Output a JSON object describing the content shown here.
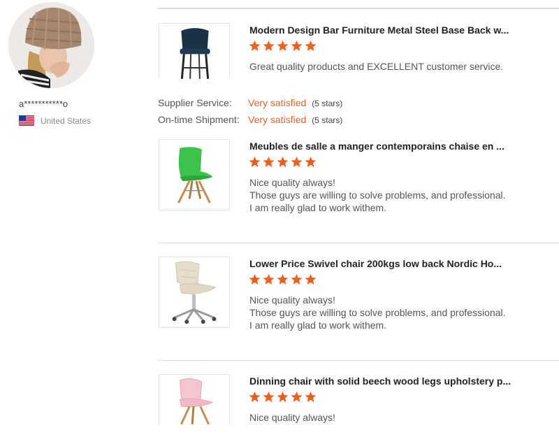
{
  "user": {
    "name": "a***********o",
    "country": "United States"
  },
  "ratings": [
    {
      "label": "Supplier Service:",
      "value": "Very satisfied",
      "note": "(5 stars)"
    },
    {
      "label": "On-time Shipment:",
      "value": "Very satisfied",
      "note": "(5 stars)"
    }
  ],
  "reviews": [
    {
      "title": "Modern Design Bar Furniture Metal Steel Base Back w...",
      "stars": 5,
      "lines": [
        "Great quality products and EXCELLENT customer service."
      ]
    },
    {
      "title": "Meubles de salle a manger contemporains chaise en ...",
      "stars": 5,
      "lines": [
        "Nice quality always!",
        "Those guys are willing to solve problems, and professional.",
        "I am really glad to work withem."
      ]
    },
    {
      "title": "Lower Price Swivel chair 200kgs low back Nordic Ho...",
      "stars": 5,
      "lines": [
        "Nice quality always!",
        "Those guys are willing to solve problems, and professional.",
        "I am really glad to work withem."
      ]
    },
    {
      "title": "Dinning chair with solid beech wood legs upholstery p...",
      "stars": 5,
      "lines": [
        "Nice quality always!"
      ]
    }
  ],
  "colors": {
    "star": "#f0601d",
    "accent": "#f0601d"
  },
  "icons": {
    "star": "star-icon",
    "flag": "us-flag-icon"
  }
}
